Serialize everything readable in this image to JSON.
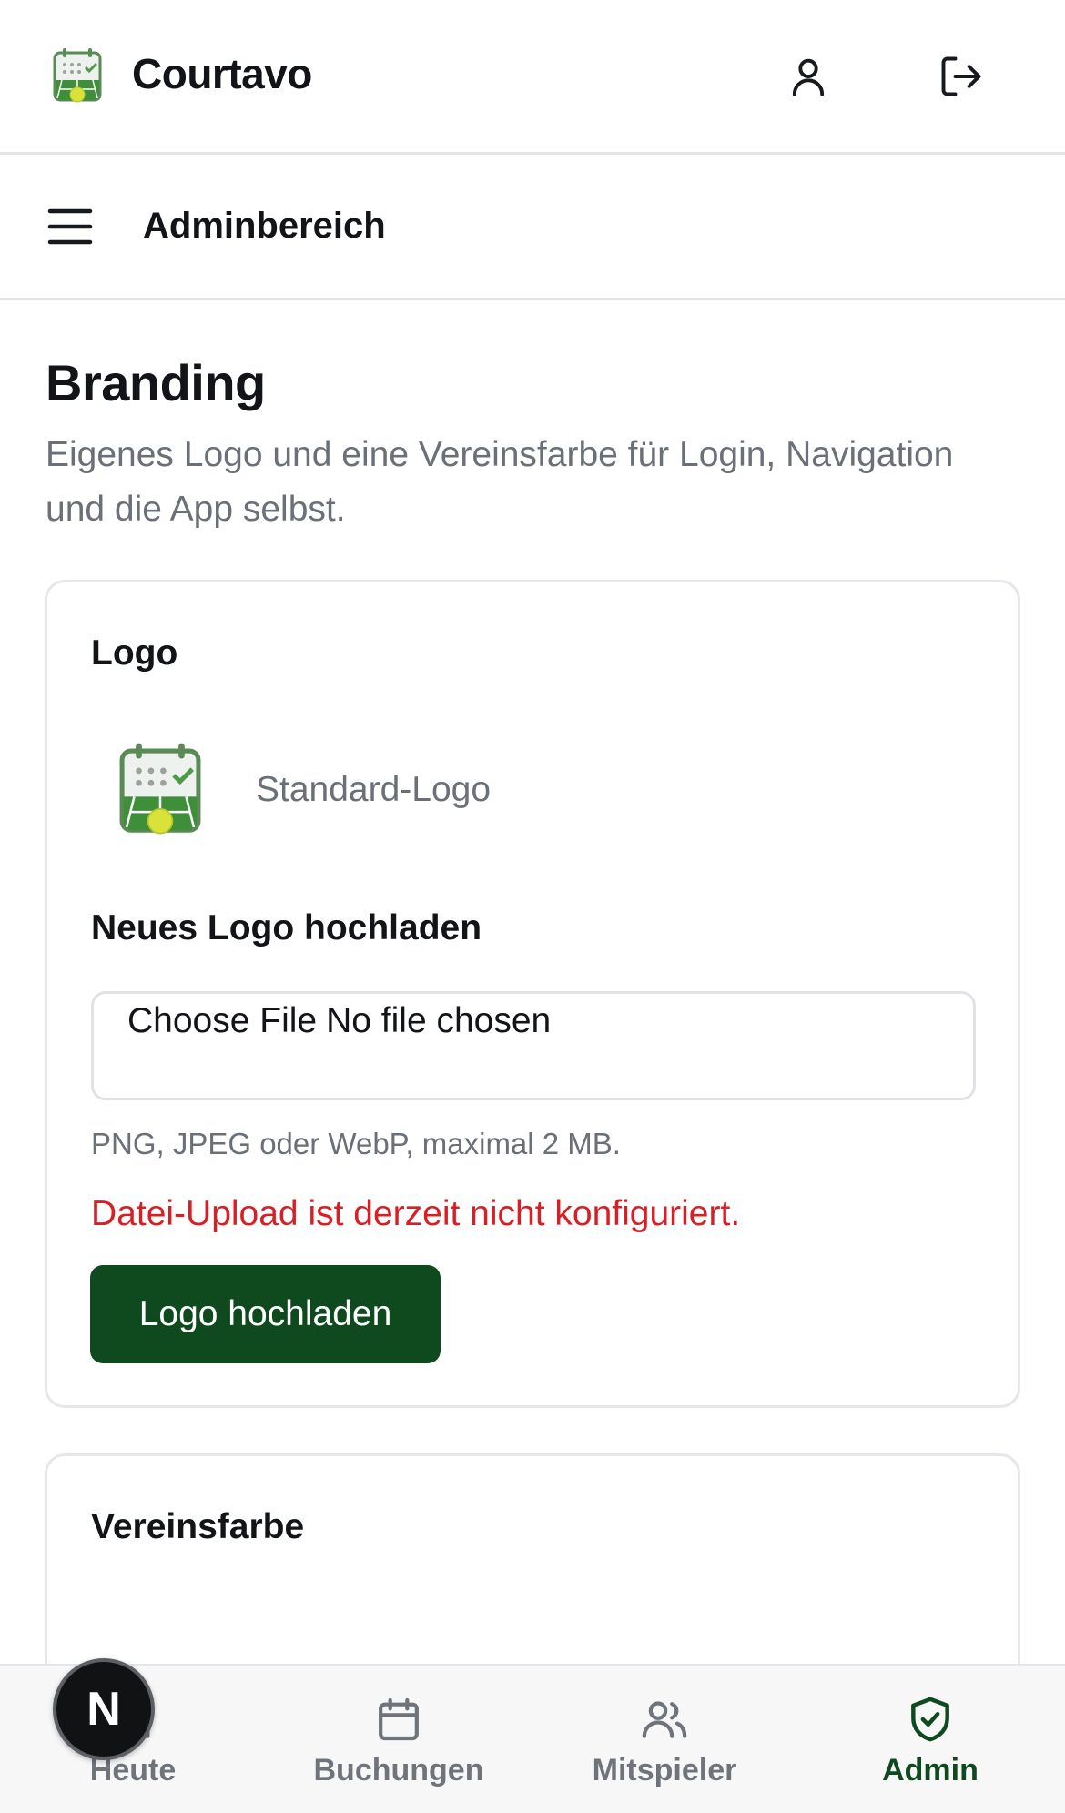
{
  "header": {
    "app_name": "Courtavo",
    "icons": [
      "user-icon",
      "logout-icon"
    ]
  },
  "subheader": {
    "title": "Adminbereich",
    "menu_icon": "hamburger-menu-icon"
  },
  "page": {
    "title": "Branding",
    "description": "Eigenes Logo und eine Vereinsfarbe für Login, Navigation und die App selbst."
  },
  "logo_card": {
    "title": "Logo",
    "current_logo_label": "Standard-Logo",
    "upload_label": "Neues Logo hochladen",
    "file_input": {
      "button_text": "Choose File",
      "status_text": "No file chosen"
    },
    "hint": "PNG, JPEG oder WebP, maximal 2 MB.",
    "error": "Datei-Upload ist derzeit nicht konfiguriert.",
    "submit_label": "Logo hochladen"
  },
  "color_card": {
    "title": "Vereinsfarbe"
  },
  "bottom_nav": {
    "items": [
      {
        "label": "Heute",
        "icon": "home-icon",
        "active": false
      },
      {
        "label": "Buchungen",
        "icon": "calendar-icon",
        "active": false
      },
      {
        "label": "Mitspieler",
        "icon": "users-icon",
        "active": false
      },
      {
        "label": "Admin",
        "icon": "shield-check-icon",
        "active": true
      }
    ]
  },
  "dev_badge": {
    "letter": "N"
  },
  "colors": {
    "primary": "#0f4a1f",
    "error": "#d81f26",
    "muted_text": "#6b7078",
    "border": "#e5e7ea"
  }
}
